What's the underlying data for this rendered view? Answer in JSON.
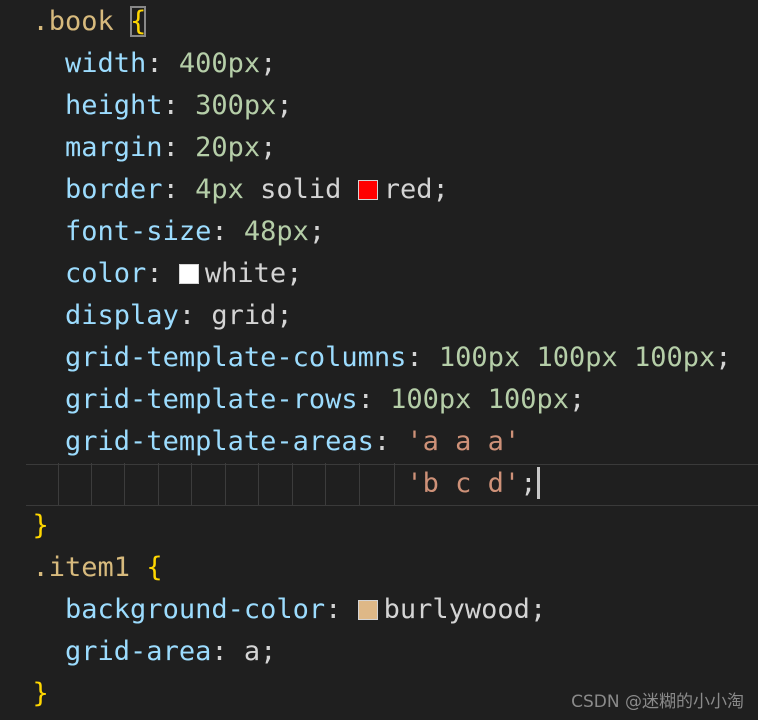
{
  "code": {
    "l1_sel": ".book",
    "l1_brace": "{",
    "l2_prop": "width",
    "l2_val": "400px",
    "l3_prop": "height",
    "l3_val": "300px",
    "l4_prop": "margin",
    "l4_val": "20px",
    "l5_prop": "border",
    "l5_num": "4px",
    "l5_kw": "solid",
    "l5_color": "red",
    "l6_prop": "font-size",
    "l6_val": "48px",
    "l7_prop": "color",
    "l7_color": "white",
    "l8_prop": "display",
    "l8_val": "grid",
    "l9_prop": "grid-template-columns",
    "l9_val": "100px 100px 100px",
    "l10_prop": "grid-template-rows",
    "l10_val": "100px 100px",
    "l11_prop": "grid-template-areas",
    "l11_val": "'a a a'",
    "l12_val": "'b c d'",
    "l13_brace": "}",
    "l14_sel": ".item1",
    "l14_brace": "{",
    "l15_prop": "background-color",
    "l15_color": "burlywood",
    "l16_prop": "grid-area",
    "l16_val": "a",
    "l17_brace": "}"
  },
  "swatch_colors": {
    "red": "#ff0000",
    "white": "#ffffff",
    "burlywood": "#deb887"
  },
  "watermark": "CSDN @迷糊的小小淘"
}
